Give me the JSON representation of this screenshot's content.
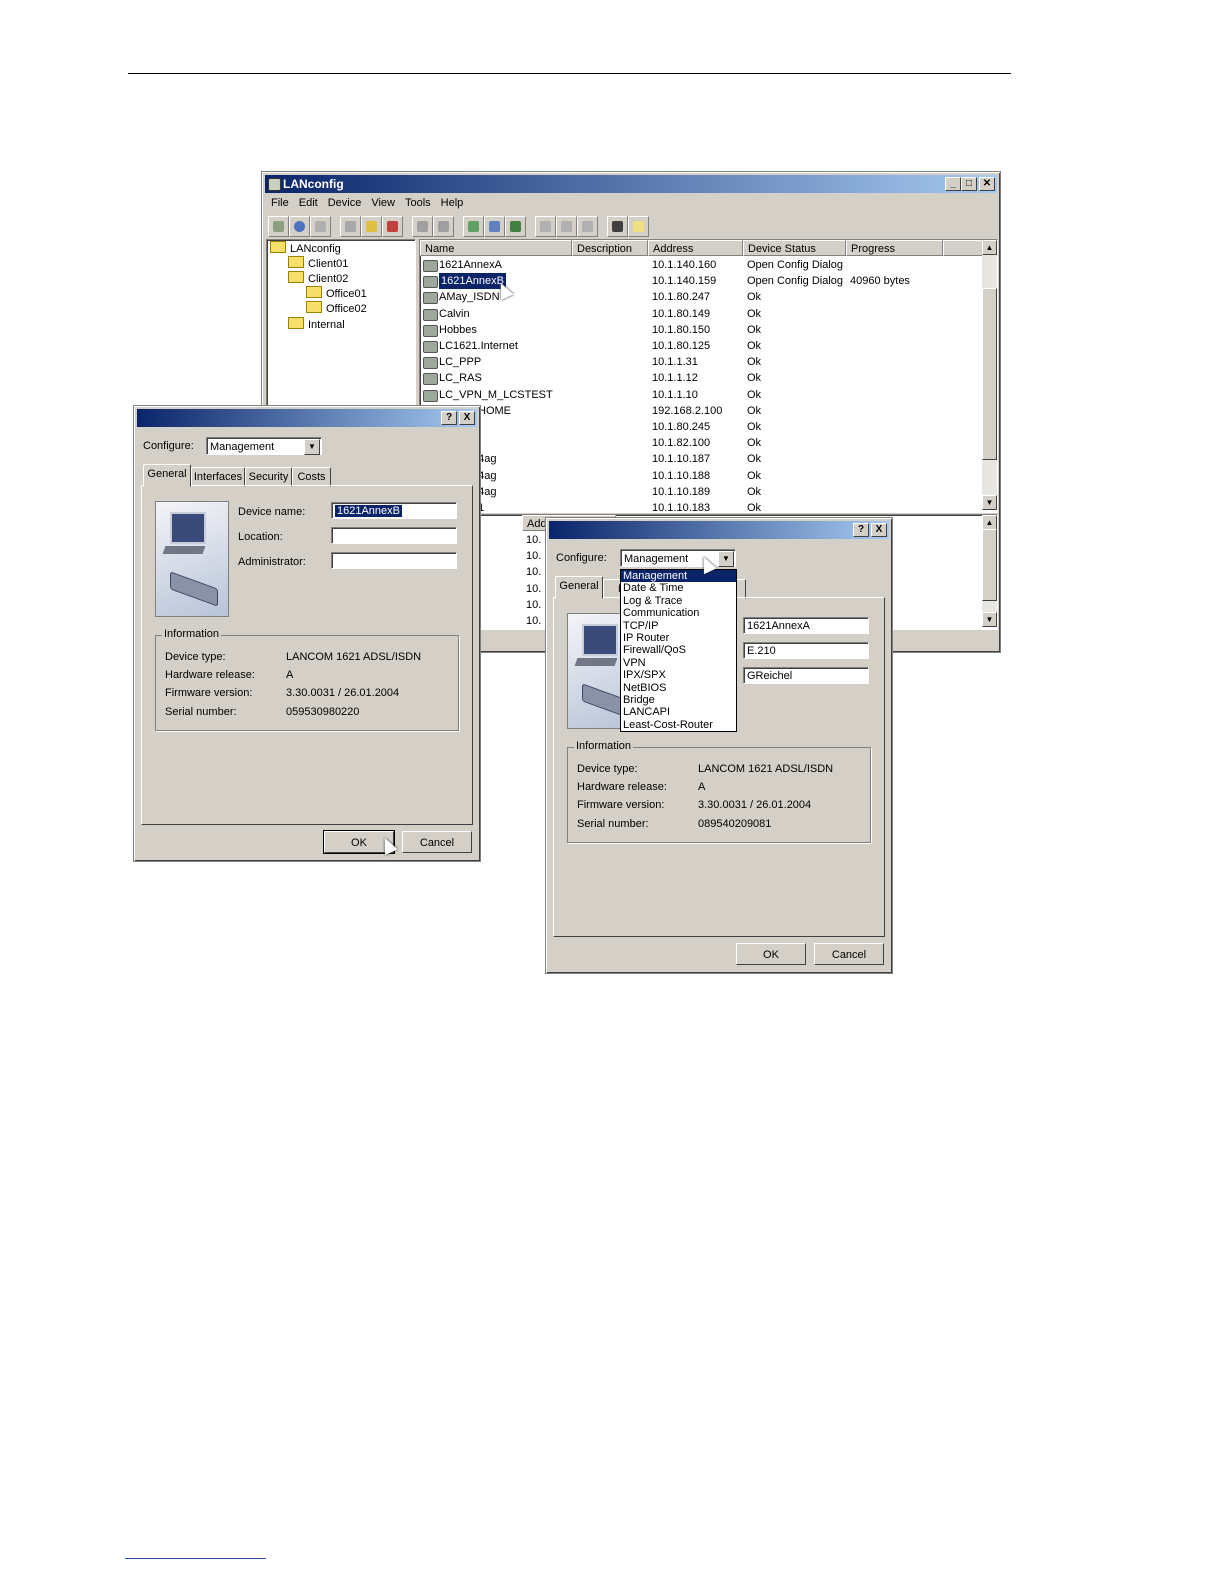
{
  "main_window": {
    "title": "LANconfig",
    "menu": [
      "File",
      "Edit",
      "Device",
      "View",
      "Tools",
      "Help"
    ],
    "tree": [
      {
        "label": "LANconfig"
      },
      {
        "label": "Client01"
      },
      {
        "label": "Client02"
      },
      {
        "label": "Office01"
      },
      {
        "label": "Office02"
      },
      {
        "label": "Internal"
      }
    ],
    "columns": [
      "Name",
      "Description",
      "Address",
      "Device Status",
      "Progress"
    ],
    "lower_columns": [
      "Add"
    ],
    "rows": [
      {
        "name": "1621AnnexA",
        "address": "10.1.140.160",
        "status": "Open Config Dialog",
        "progress": ""
      },
      {
        "name": "1621AnnexB",
        "address": "10.1.140.159",
        "status": "Open Config Dialog",
        "progress": "40960 bytes"
      },
      {
        "name": "AMay_ISDN",
        "address": "10.1.80.247",
        "status": "Ok",
        "progress": ""
      },
      {
        "name": "Calvin",
        "address": "10.1.80.149",
        "status": "Ok",
        "progress": ""
      },
      {
        "name": "Hobbes",
        "address": "10.1.80.150",
        "status": "Ok",
        "progress": ""
      },
      {
        "name": "LC1621.Internet",
        "address": "10.1.80.125",
        "status": "Ok",
        "progress": ""
      },
      {
        "name": "LC_PPP",
        "address": "10.1.1.31",
        "status": "Ok",
        "progress": ""
      },
      {
        "name": "LC_RAS",
        "address": "10.1.1.12",
        "status": "Ok",
        "progress": ""
      },
      {
        "name": "LC_VPN_M_LCSTEST",
        "address": "10.1.1.10",
        "status": "Ok",
        "progress": ""
      },
      {
        "name": "HOME",
        "address": "192.168.2.100",
        "status": "Ok",
        "progress": ""
      },
      {
        "name": "",
        "address": "10.1.80.245",
        "status": "Ok",
        "progress": ""
      },
      {
        "name": "",
        "address": "10.1.82.100",
        "status": "Ok",
        "progress": ""
      },
      {
        "name": "54ag",
        "address": "10.1.10.187",
        "status": "Ok",
        "progress": ""
      },
      {
        "name": "54ag",
        "address": "10.1.10.188",
        "status": "Ok",
        "progress": ""
      },
      {
        "name": "54ag",
        "address": "10.1.10.189",
        "status": "Ok",
        "progress": ""
      },
      {
        "name": "01",
        "address": "10.1.10.183",
        "status": "Ok",
        "progress": ""
      }
    ],
    "lower_rows": [
      "10.",
      "10.",
      "10.",
      "10.",
      "10.",
      "10."
    ]
  },
  "dialog1": {
    "help_label": "?",
    "close_label": "X",
    "configure_label": "Configure:",
    "configure_value": "Management",
    "tabs": [
      "General",
      "Interfaces",
      "Security",
      "Costs"
    ],
    "device_name_label": "Device name:",
    "device_name_value": "1621AnnexB",
    "location_label": "Location:",
    "location_value": "",
    "administrator_label": "Administrator:",
    "administrator_value": "",
    "info_title": "Information",
    "info": [
      {
        "label": "Device type:",
        "value": "LANCOM 1621 ADSL/ISDN"
      },
      {
        "label": "Hardware release:",
        "value": "A"
      },
      {
        "label": "Firmware version:",
        "value": "3.30.0031 / 26.01.2004"
      },
      {
        "label": "Serial number:",
        "value": "059530980220"
      }
    ],
    "ok_label": "OK",
    "cancel_label": "Cancel"
  },
  "dialog2": {
    "help_label": "?",
    "close_label": "X",
    "configure_label": "Configure:",
    "configure_value": "Management",
    "tabs": [
      "General",
      "Int"
    ],
    "dropdown_items": [
      "Management",
      "Date & Time",
      "Log & Trace",
      "Communication",
      "TCP/IP",
      "IP Router",
      "Firewall/QoS",
      "VPN",
      "IPX/SPX",
      "NetBIOS",
      "Bridge",
      "LANCAPI",
      "Least-Cost-Router"
    ],
    "device_name_value": "1621AnnexA",
    "location_value": "E.210",
    "administrator_value": "GReichel",
    "info_title": "Information",
    "info": [
      {
        "label": "Device type:",
        "value": "LANCOM 1621 ADSL/ISDN"
      },
      {
        "label": "Hardware release:",
        "value": "A"
      },
      {
        "label": "Firmware version:",
        "value": "3.30.0031 / 26.01.2004"
      },
      {
        "label": "Serial number:",
        "value": "089540209081"
      }
    ],
    "ok_label": "OK",
    "cancel_label": "Cancel"
  },
  "icons": {
    "title_app_icon": "network-icon",
    "device_icon": "router-icon",
    "folder_icon": "folder-icon",
    "cursor": "mouse-pointer-icon"
  },
  "colors": {
    "title_gradient_start": "#0a246a",
    "title_gradient_end": "#a6caf0",
    "selection": "#0a246a",
    "window_face": "#d4d0c8"
  }
}
